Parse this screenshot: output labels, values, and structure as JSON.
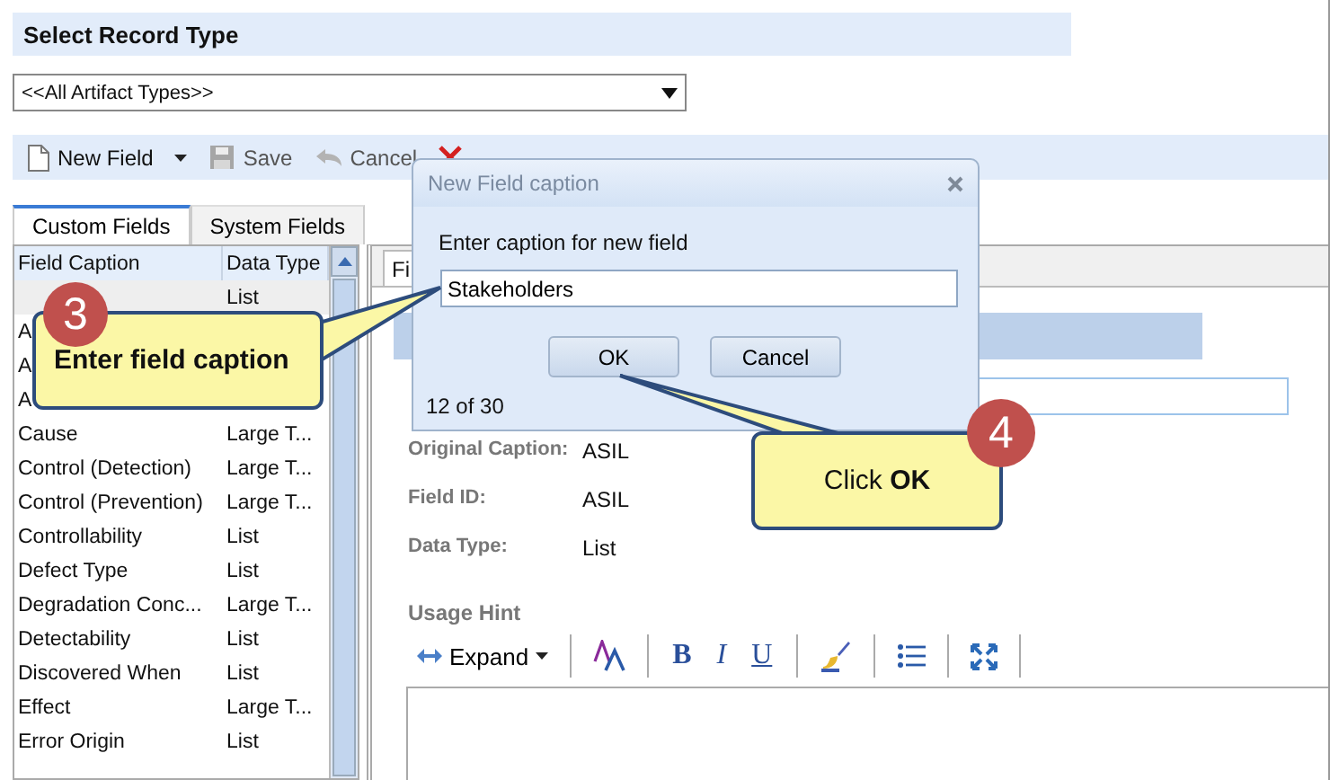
{
  "record_type": {
    "title": "Select Record Type",
    "value": "<<All Artifact Types>>"
  },
  "toolbar": [
    {
      "kind": "new",
      "label": "New Field",
      "menu": true,
      "disabled": false
    },
    {
      "kind": "save",
      "label": "Save",
      "menu": false,
      "disabled": true
    },
    {
      "kind": "cancel",
      "label": "Cancel",
      "menu": false,
      "disabled": true
    },
    {
      "kind": "delete",
      "menu": false,
      "disabled": false
    }
  ],
  "field_tabs": [
    {
      "label": "Custom Fields",
      "selected": true
    },
    {
      "label": "System Fields",
      "selected": false
    }
  ],
  "fields_table": {
    "columns": [
      "Field Caption",
      "Data Type"
    ],
    "rows": [
      {
        "data_type": "List",
        "selected": true
      },
      {
        "caption": "A",
        "selected": false
      },
      {
        "caption": "A",
        "selected": false
      },
      {
        "caption": "A",
        "selected": false
      },
      {
        "caption": "Cause",
        "data_type": "Large T...",
        "selected": false
      },
      {
        "caption": "Control (Detection)",
        "data_type": "Large T...",
        "selected": false
      },
      {
        "caption": "Control (Prevention)",
        "data_type": "Large T...",
        "selected": false
      },
      {
        "caption": "Controllability",
        "data_type": "List",
        "selected": false
      },
      {
        "caption": "Defect Type",
        "data_type": "List",
        "selected": false
      },
      {
        "caption": "Degradation Conc...",
        "data_type": "Large T...",
        "selected": false
      },
      {
        "caption": "Detectability",
        "data_type": "List",
        "selected": false
      },
      {
        "caption": "Discovered When",
        "data_type": "List",
        "selected": false
      },
      {
        "caption": "Effect",
        "data_type": "Large T...",
        "selected": false
      },
      {
        "caption": "Error Origin",
        "data_type": "List",
        "selected": false
      }
    ]
  },
  "detail": {
    "tab": "Fi",
    "properties": [
      {
        "label": "Original Caption:",
        "value": "ASIL"
      },
      {
        "label": "Field ID:",
        "value": "ASIL"
      },
      {
        "label": "Data Type:",
        "value": "List"
      }
    ],
    "usage_hint": {
      "label": "Usage Hint",
      "expand": "Expand",
      "format_buttons": [
        {
          "kind": "bold",
          "label": "B"
        },
        {
          "kind": "italic",
          "label": "I"
        },
        {
          "kind": "underline",
          "label": "U"
        }
      ]
    }
  },
  "dialog": {
    "title": "New Field caption",
    "prompt": "Enter caption for new field",
    "value": "Stakeholders",
    "buttons": [
      "OK",
      "Cancel"
    ],
    "counter": "12 of 30"
  },
  "callouts": [
    {
      "number": "3",
      "text": "Enter field caption"
    },
    {
      "number": "4",
      "text": "Click **OK**"
    }
  ]
}
